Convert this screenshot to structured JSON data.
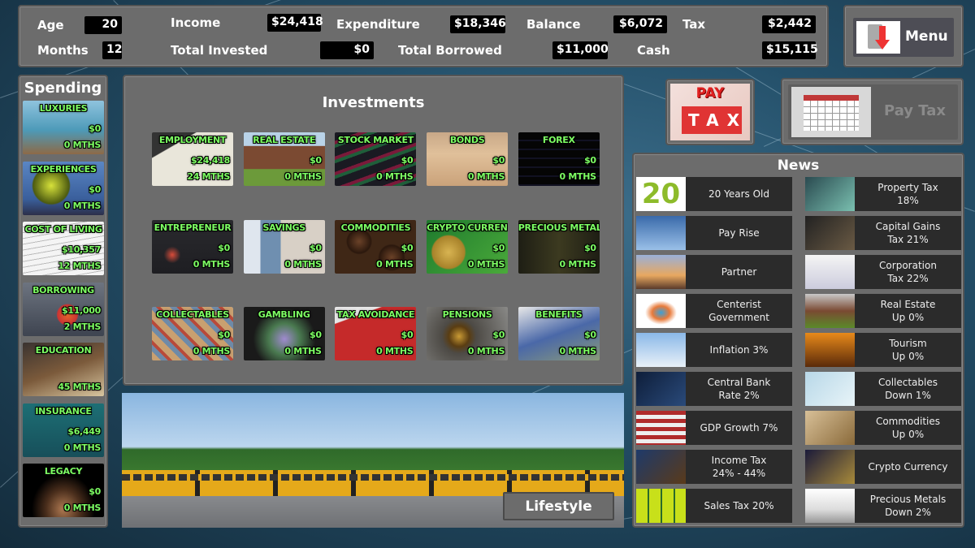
{
  "stats": {
    "age": {
      "label": "Age",
      "value": "20"
    },
    "months": {
      "label": "Months",
      "value": "12"
    },
    "income": {
      "label": "Income",
      "value": "$24,418"
    },
    "expenditure": {
      "label": "Expenditure",
      "value": "$18,346"
    },
    "balance": {
      "label": "Balance",
      "value": "$6,072"
    },
    "tax": {
      "label": "Tax",
      "value": "$2,442"
    },
    "total_invested": {
      "label": "Total Invested",
      "value": "$0"
    },
    "total_borrowed": {
      "label": "Total Borrowed",
      "value": "$11,000"
    },
    "cash": {
      "label": "Cash",
      "value": "$15,115"
    }
  },
  "menu": {
    "label": "Menu",
    "icon": "menu-download-icon"
  },
  "pay_tax": {
    "image_text_top": "PAY",
    "image_text_bottom": "TAX",
    "button_label": "Pay Tax",
    "icon": "calendar-icon"
  },
  "spending": {
    "title": "Spending",
    "items": [
      {
        "name": "Luxuries",
        "value": "$0",
        "months": "0 MTHS",
        "bg": "linear-gradient(180deg,#8fc3de,#4d9ab8 55%,#8d6a47)"
      },
      {
        "name": "Experiences",
        "value": "$0",
        "months": "0 MTHS",
        "bg": "radial-gradient(circle at 35% 45%,#d7e23a 0,#4c5a10 30%,transparent 32%),linear-gradient(180deg,#5a86c4,#3a5f9c 70%,#2c2f4a)"
      },
      {
        "name": "Cost of Living",
        "value": "$10,357",
        "months": "12 MTHS",
        "bg": "repeating-linear-gradient(170deg,#f4f4f4 0 6px,#bbb 6px 7px)"
      },
      {
        "name": "Borrowing",
        "value": "$11,000",
        "months": "2 MTHS",
        "bg": "radial-gradient(circle at 55% 60%,#e46a2b 0,#c33 18%,transparent 20%),linear-gradient(180deg,#6d7480,#3e4450)"
      },
      {
        "name": "Education",
        "value": "",
        "months": "45 MTHS",
        "bg": "linear-gradient(160deg,#3a3330,#7b5a3b 50%,#d8c6a0)"
      },
      {
        "name": "Insurance",
        "value": "$6,449",
        "months": "0 MTHS",
        "bg": "linear-gradient(180deg,#1d6f75,#174f5a)"
      },
      {
        "name": "Legacy",
        "value": "$0",
        "months": "0 MTHS",
        "bg": "radial-gradient(ellipse at 50% 85%,#b07a52 0,#4a2e1c 30%,#000 55%)"
      }
    ]
  },
  "investments": {
    "title": "Investments",
    "items": [
      {
        "name": "Employment",
        "value": "$24,418",
        "months": "24 MTHS",
        "bg": "linear-gradient(150deg,#333 0 25%,#e9e6da 26%)"
      },
      {
        "name": "Real Estate",
        "value": "$0",
        "months": "0 MTHS",
        "bg": "linear-gradient(180deg,#b9d3e8 0 25%,#7b4a32 26% 68%,#6c9a3a 69%)"
      },
      {
        "name": "Stock Market",
        "value": "$0",
        "months": "0 MTHS",
        "bg": "repeating-linear-gradient(160deg,#1a1a22 0 10px,#7a1a3a 10px 14px,#1f5e3a 14px 18px)"
      },
      {
        "name": "Bonds",
        "value": "$0",
        "months": "0 MTHS",
        "bg": "linear-gradient(180deg,#c8a888,#e0c09a 40%,#caa27a)"
      },
      {
        "name": "Forex",
        "value": "$0",
        "months": "0 MTHS",
        "bg": "repeating-linear-gradient(180deg,#050505 0 9px,#112 9px 11px)"
      },
      {
        "name": "Entrepreneur",
        "value": "$0",
        "months": "0 MTHS",
        "bg": "radial-gradient(circle at 25% 65%,#d94c3a 0,transparent 12%),linear-gradient(180deg,#2a2a2e,#1e1e22)"
      },
      {
        "name": "Savings",
        "value": "$0",
        "months": "0 MTHS",
        "bg": "linear-gradient(90deg,#dfe6ee 0 20%,#6f8fb0 21% 45%,#d8d0c6 46%)"
      },
      {
        "name": "Commodities",
        "value": "$0",
        "months": "0 MTHS",
        "bg": "radial-gradient(circle at 30% 40%,#6b4228 0,#2b180d 18%,transparent 20%),radial-gradient(circle at 70% 70%,#6b4228 0,#2b180d 18%,transparent 20%),#3f2716"
      },
      {
        "name": "Crypto Currency",
        "value": "$0",
        "months": "0 MTHS",
        "bg": "radial-gradient(circle at 27% 60%,#d8b452 0,#a8822a 24%,transparent 26%),linear-gradient(135deg,#1f7a2e,#4aaa3a)"
      },
      {
        "name": "Precious Metals",
        "value": "$0",
        "months": "0 MTHS",
        "bg": "linear-gradient(90deg,#1e1e14,#3c3a20 50%,#1e1e14)"
      },
      {
        "name": "Collectables",
        "value": "$0",
        "months": "0 MTHS",
        "bg": "repeating-linear-gradient(45deg,#c9a070 0 8px,#6e8aa8 8px 14px,#b84a3a 14px 18px)"
      },
      {
        "name": "Gambling",
        "value": "$0",
        "months": "0 MTHS",
        "bg": "radial-gradient(circle at 50% 60%,#a08ad0 0,#4a7a50 30%,#1a1a1a 60%)"
      },
      {
        "name": "Tax Avoidance",
        "value": "$0",
        "months": "0 MTHS",
        "bg": "linear-gradient(160deg,#e7e7e7 0 20%,#c52a2a 21%)"
      },
      {
        "name": "Pensions",
        "value": "$0",
        "months": "0 MTHS",
        "bg": "radial-gradient(circle at 40% 55%,#c99a34 0,#5a3d12 18%,#4d4a45 30%,#8a8a88)"
      },
      {
        "name": "Benefits",
        "value": "$0",
        "months": "0 MTHS",
        "bg": "linear-gradient(160deg,#e8e8e8,#4a68a8 50%,#8a9a7a)"
      }
    ]
  },
  "lifestyle": {
    "label": "Lifestyle"
  },
  "news": {
    "title": "News",
    "items": [
      {
        "text": "20 Years Old",
        "bg": "linear-gradient(#fff,#fff)",
        "thumb_text": "20"
      },
      {
        "text": "Property Tax\n18%",
        "bg": "linear-gradient(135deg,#2a4a50,#7ac0b0)"
      },
      {
        "text": "Pay Rise",
        "bg": "linear-gradient(180deg,#3a6aaa,#9ac0e8)"
      },
      {
        "text": "Capital Gains\nTax 21%",
        "bg": "linear-gradient(135deg,#222,#6a5a44)"
      },
      {
        "text": "Partner",
        "bg": "linear-gradient(180deg,#9ab0d8,#e8a860 60%,#5a3a2a)"
      },
      {
        "text": "Corporation\nTax 22%",
        "bg": "linear-gradient(180deg,#f4f4f4,#ccd)"
      },
      {
        "text": "Centerist\nGovernment",
        "bg": "radial-gradient(ellipse at 50% 55%,#3aa0d8 0,#e87a3a 25%,#fff 45%)"
      },
      {
        "text": "Real Estate\nUp 0%",
        "bg": "linear-gradient(180deg,#c8c8c8,#7a4a32 50%,#5a8a2a)"
      },
      {
        "text": "Inflation 3%",
        "bg": "linear-gradient(180deg,#8ab8e8,#e8f0f8)"
      },
      {
        "text": "Tourism\nUp 0%",
        "bg": "linear-gradient(180deg,#e88a1a,#5a2a0a)"
      },
      {
        "text": "Central Bank\nRate 2%",
        "bg": "linear-gradient(135deg,#0e1e3a,#2a4a7a)"
      },
      {
        "text": "Collectables\nDown 1%",
        "bg": "linear-gradient(135deg,#b8d8e8,#e8f4f8)"
      },
      {
        "text": "GDP Growth 7%",
        "bg": "repeating-linear-gradient(180deg,#b02a2a 0 5px,#eee 5px 10px)"
      },
      {
        "text": "Commodities\nUp 0%",
        "bg": "linear-gradient(135deg,#d8c098,#8a6a3a)"
      },
      {
        "text": "Income Tax\n24% - 44%",
        "bg": "linear-gradient(135deg,#1e3a6a,#5a3a1a)"
      },
      {
        "text": "Crypto Currency",
        "bg": "linear-gradient(135deg,#1a1a3a,#a88a3a)"
      },
      {
        "text": "Sales Tax 20%",
        "bg": "repeating-linear-gradient(90deg,#c8e01a 0 14px,#2a6a2a 14px 16px)"
      },
      {
        "text": "Precious Metals\nDown 2%",
        "bg": "linear-gradient(180deg,#fff,#ddd 60%,#999)"
      }
    ]
  },
  "colors": {
    "panel": "#6c6c6c",
    "label_green": "#7dff63",
    "news_bg": "#2b2b2b"
  }
}
